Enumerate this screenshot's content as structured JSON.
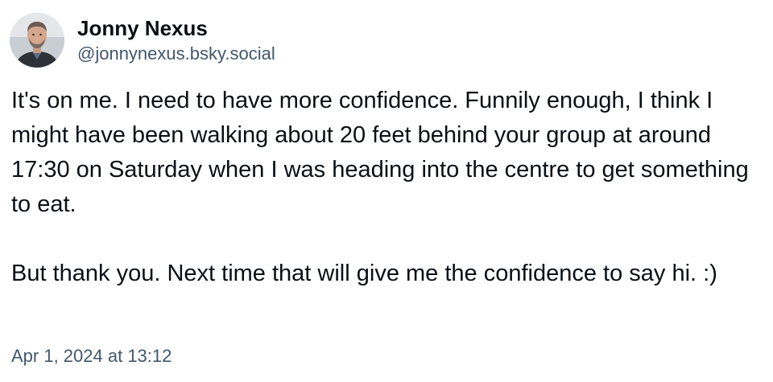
{
  "author": {
    "display_name": "Jonny Nexus",
    "handle": "@jonnynexus.bsky.social",
    "avatar_icon": "user-avatar-photo"
  },
  "post": {
    "paragraphs": [
      "It's on me. I need to have more confidence. Funnily enough, I think I might have been walking about 20 feet behind your group at around 17:30 on Saturday when I was heading into the centre to get something to eat.",
      "But thank you. Next time that will give me the confidence to say hi. :)"
    ],
    "timestamp": "Apr 1, 2024 at 13:12"
  },
  "colors": {
    "text": "#0b0f14",
    "muted": "#42576c",
    "background": "#ffffff"
  }
}
